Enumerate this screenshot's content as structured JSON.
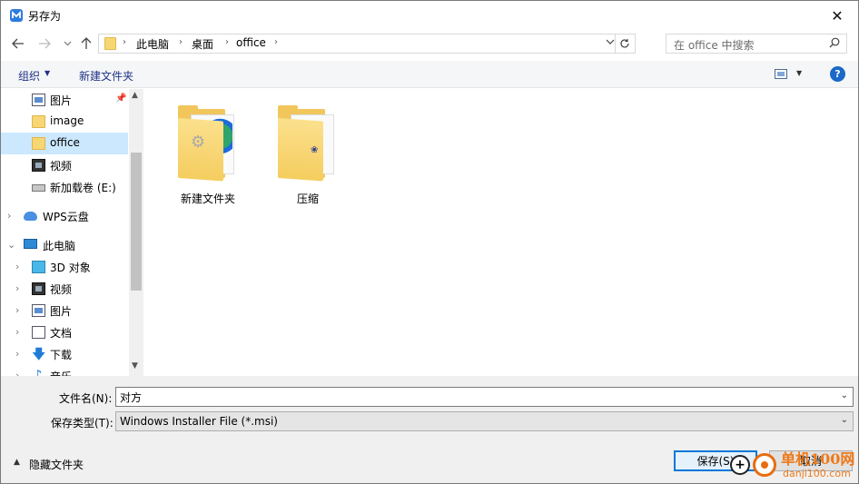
{
  "window": {
    "title": "另存为",
    "close_glyph": "✕"
  },
  "address": {
    "breadcrumbs": [
      "此电脑",
      "桌面",
      "office"
    ],
    "separator": "›",
    "search_placeholder": "在 office 中搜索"
  },
  "toolbar": {
    "organize_label": "组织",
    "new_folder_label": "新建文件夹",
    "help_label": "?"
  },
  "nav": {
    "items": [
      {
        "label": "图片",
        "icon": "picture-icon",
        "pinned": true
      },
      {
        "label": "image",
        "icon": "folder-icon"
      },
      {
        "label": "office",
        "icon": "folder-icon",
        "selected": true
      },
      {
        "label": "视频",
        "icon": "video-icon"
      },
      {
        "label": "新加载卷 (E:)",
        "icon": "drive-icon"
      },
      {
        "label": "WPS云盘",
        "icon": "cloud-icon"
      },
      {
        "label": "此电脑",
        "icon": "pc-icon"
      },
      {
        "label": "3D 对象",
        "icon": "3d-objects-icon"
      },
      {
        "label": "视频",
        "icon": "video-icon"
      },
      {
        "label": "图片",
        "icon": "picture-icon"
      },
      {
        "label": "文档",
        "icon": "document-icon"
      },
      {
        "label": "下载",
        "icon": "download-icon"
      },
      {
        "label": "音乐",
        "icon": "music-icon"
      }
    ]
  },
  "files": [
    {
      "name": "新建文件夹",
      "icon": "folder-with-app-icon"
    },
    {
      "name": "压缩",
      "icon": "folder-icon"
    }
  ],
  "form": {
    "filename_label": "文件名(N):",
    "filename_value": "对方",
    "filetype_label": "保存类型(T):",
    "filetype_value": "Windows Installer File (*.msi)",
    "hide_folders_label": "隐藏文件夹",
    "save_label": "保存(S)",
    "cancel_label": "取消"
  },
  "watermark": {
    "line1": "单机100网",
    "line2": "danji100.com"
  },
  "colors": {
    "accent": "#0078d7",
    "selection": "#cce8ff",
    "toolbar_text": "#1e3287",
    "folder": "#f7d774"
  }
}
